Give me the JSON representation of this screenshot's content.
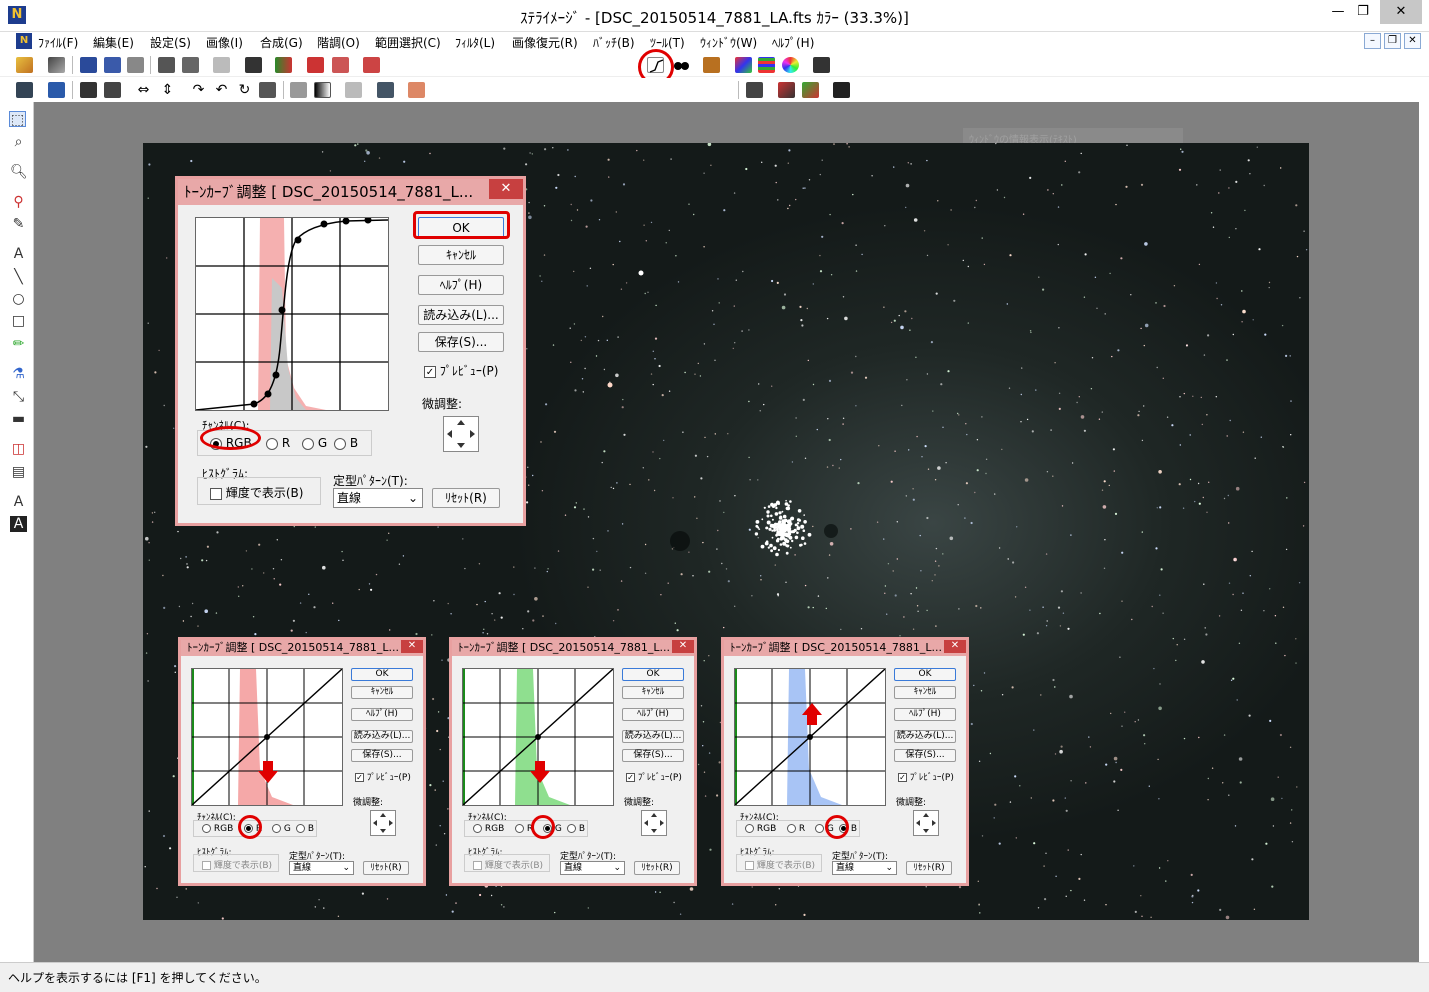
{
  "window": {
    "title": "ｽﾃﾗｲﾒｰｼﾞ - [DSC_20150514_7881_LA.fts ｶﾗｰ (33.3%)]",
    "minimize": "—",
    "maximize": "❐",
    "close": "✕"
  },
  "menu": {
    "items": [
      "ﾌｧｲﾙ(F)",
      "編集(E)",
      "設定(S)",
      "画像(I)",
      "合成(G)",
      "階調(O)",
      "範囲選択(C)",
      "ﾌｨﾙﾀ(L)",
      "画像復元(R)",
      "ﾊﾞｯﾁ(B)",
      "ﾂｰﾙ(T)",
      "ｳｨﾝﾄﾞｳ(W)",
      "ﾍﾙﾌﾟ(H)"
    ],
    "mdi_minimize": "–",
    "mdi_restore": "❐",
    "mdi_close": "✕"
  },
  "mdi_hidden_title": "ｳｨﾝﾄﾞｳの情報表示(ﾃｷｽﾄ)",
  "status": {
    "text": "ヘルプを表示するには [F1] を押してください。"
  },
  "main_dialog": {
    "title": "ﾄｰﾝｶｰﾌﾞ調整 [ DSC_20150514_7881_L...",
    "close": "✕",
    "ok": "OK",
    "cancel": "ｷｬﾝｾﾙ",
    "help": "ﾍﾙﾌﾟ(H)",
    "load": "読み込み(L)...",
    "save": "保存(S)...",
    "preview": "ﾌﾟﾚﾋﾞｭｰ(P)",
    "preview_checked": "✓",
    "fine_adjust": "微調整:",
    "channel_label": "ﾁｬﾝﾈﾙ(C):",
    "channels": [
      "RGB",
      "R",
      "G",
      "B"
    ],
    "selected_channel": "RGB",
    "histogram_label": "ﾋｽﾄｸﾞﾗﾑ:",
    "luminance": "輝度で表示(B)",
    "pattern_label": "定型ﾊﾟﾀｰﾝ(T):",
    "pattern_value": "直線",
    "reset": "ﾘｾｯﾄ(R)"
  },
  "small_dialogs": [
    {
      "title": "ﾄｰﾝｶｰﾌﾞ調整 [ DSC_20150514_7881_L...",
      "selected_channel": "R",
      "hist_color": "#f5a8a8",
      "arrow": "down"
    },
    {
      "title": "ﾄｰﾝｶｰﾌﾞ調整 [ DSC_20150514_7881_L...",
      "selected_channel": "G",
      "hist_color": "#8fdf8f",
      "arrow": "down"
    },
    {
      "title": "ﾄｰﾝｶｰﾌﾞ調整 [ DSC_20150514_7881_L...",
      "selected_channel": "B",
      "hist_color": "#a8c4f5",
      "arrow": "up"
    }
  ],
  "colors": {
    "dialog_border": "#e8a0a0",
    "dialog_title": "#e8a8a8",
    "annotation_red": "#e00000",
    "workspace": "#808080"
  }
}
